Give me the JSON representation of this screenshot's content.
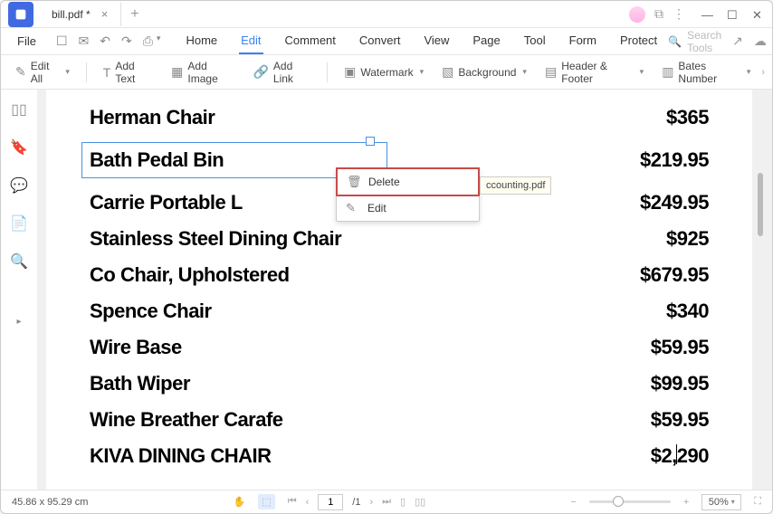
{
  "window": {
    "tab_title": "bill.pdf *",
    "title_icons": {
      "circle": true
    }
  },
  "menubar": {
    "file": "File",
    "tabs": [
      "Home",
      "Edit",
      "Comment",
      "Convert",
      "View",
      "Page",
      "Tool",
      "Form",
      "Protect"
    ],
    "active_index": 1,
    "search_placeholder": "Search Tools"
  },
  "toolbar": {
    "edit_all": "Edit All",
    "add_text": "Add Text",
    "add_image": "Add Image",
    "add_link": "Add Link",
    "watermark": "Watermark",
    "background": "Background",
    "header_footer": "Header & Footer",
    "bates_number": "Bates Number"
  },
  "document": {
    "items": [
      {
        "name": "Herman Chair",
        "price": "$365",
        "selected": false
      },
      {
        "name": "Bath Pedal Bin",
        "price": "$219.95",
        "selected": true
      },
      {
        "name": "Carrie Portable L",
        "price": "$249.95",
        "selected": false
      },
      {
        "name": "Stainless Steel Dining Chair",
        "price": "$925",
        "selected": false
      },
      {
        "name": "Co Chair, Upholstered",
        "price": "$679.95",
        "selected": false
      },
      {
        "name": "Spence Chair",
        "price": "$340",
        "selected": false
      },
      {
        "name": "Wire Base",
        "price": "$59.95",
        "selected": false
      },
      {
        "name": "Bath Wiper",
        "price": "$99.95",
        "selected": false
      },
      {
        "name": "Wine Breather Carafe",
        "price": "$59.95",
        "selected": false
      },
      {
        "name": "KIVA DINING CHAIR",
        "price": "$2,290",
        "selected": false
      }
    ]
  },
  "context_menu": {
    "items": [
      {
        "label": "Delete",
        "highlighted": true
      },
      {
        "label": "Edit",
        "highlighted": false
      }
    ]
  },
  "tooltip": "ccounting.pdf",
  "statusbar": {
    "dimensions": "45.86 x 95.29 cm",
    "page_current": "1",
    "page_total": "/1",
    "zoom": "50%"
  }
}
